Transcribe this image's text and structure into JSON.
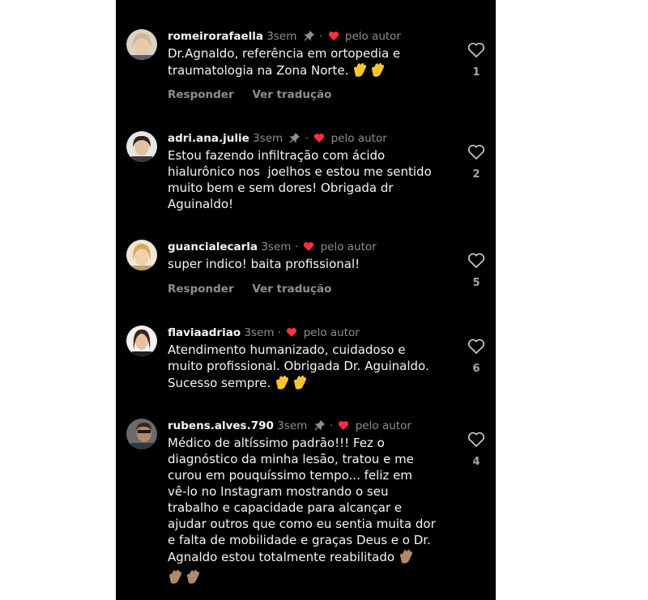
{
  "comments": [
    {
      "username": "romeirorafaella",
      "time": "3sem",
      "author_tag": "pelo autor",
      "text": "Dr.Agnaldo, referência em ortopedia e\ntraumatologia na Zona Norte.",
      "reply_label": "Responder",
      "translate_label": "Ver tradução",
      "likes": "1",
      "pinned": true
    },
    {
      "username": "adri.ana.julie",
      "time": "3sem",
      "author_tag": "pelo autor",
      "text": "Estou fazendo infiltração com ácido\nhialurônico nos  joelhos e estou me sentido\nmuito bem e sem dores! Obrigada dr\nAguinaldo!",
      "likes": "2",
      "pinned": true
    },
    {
      "username": "guancialecarla",
      "time": "3sem",
      "author_tag": "pelo autor",
      "text": "super indico! baita profissional!",
      "reply_label": "Responder",
      "translate_label": "Ver tradução",
      "likes": "5",
      "pinned": false
    },
    {
      "username": "flaviaadriao",
      "time": "3sem",
      "author_tag": "pelo autor",
      "text": "Atendimento humanizado, cuidadoso e\nmuito profissional. Obrigada Dr. Aguinaldo.\nSucesso sempre.",
      "likes": "6",
      "pinned": false
    },
    {
      "username": "rubens.alves.790",
      "time": "3sem",
      "author_tag": "pelo autor",
      "text": "Médico de altíssimo padrão!!! Fez o\ndiagnóstico da minha lesão, tratou e me\ncurou em pouquíssimo tempo... feliz em\nvê-lo no Instagram mostrando o seu\ntrabalho e capacidade para alcançar e\najudar outros que como eu sentia muita dor\ne falta de mobilidade e graças Deus e o Dr.\nAgnaldo estou totalmente reabilitado",
      "likes": "4",
      "pinned": true
    }
  ],
  "colors": {
    "background": "#000000",
    "username": "#f5f5f5",
    "meta": "#8e8e8e",
    "author_heart": "#ff3040",
    "clap_yellow": "#f7c531",
    "clap_tan": "#b08a6a"
  },
  "icons": [
    "pin-icon",
    "author-heart-icon",
    "like-heart-icon",
    "clapping-hands-emoji"
  ]
}
